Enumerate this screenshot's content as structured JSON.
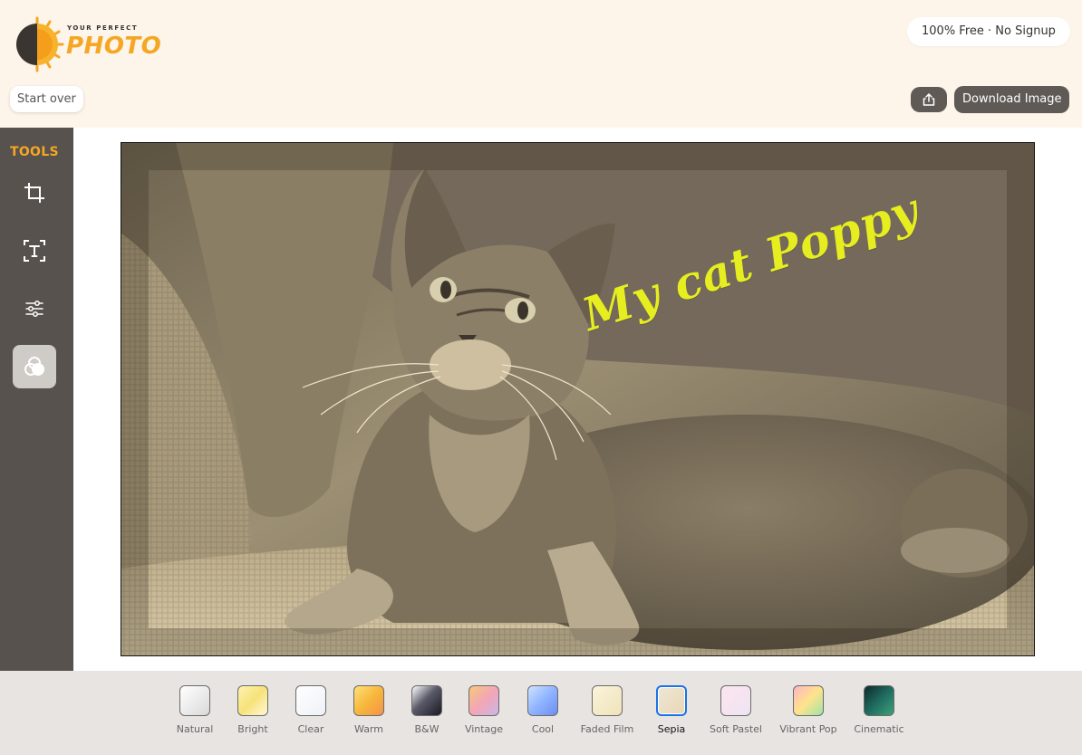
{
  "header": {
    "logo_small": "YOUR PERFECT",
    "logo_big": "PHOTO",
    "badge": "100% Free · No Signup",
    "start_over": "Start over",
    "download": "Download Image"
  },
  "sidebar": {
    "title": "TOOLS",
    "tools": [
      {
        "name": "crop",
        "icon": "crop-icon",
        "active": false
      },
      {
        "name": "text",
        "icon": "text-icon",
        "active": false
      },
      {
        "name": "adjust",
        "icon": "sliders-icon",
        "active": false
      },
      {
        "name": "filters",
        "icon": "filters-icon",
        "active": true
      }
    ]
  },
  "canvas": {
    "overlay_text": "My cat Poppy",
    "overlay_color": "#e6ee1f",
    "filter_applied": "Sepia"
  },
  "filters": {
    "selected": "Sepia",
    "items": [
      {
        "label": "Natural"
      },
      {
        "label": "Bright"
      },
      {
        "label": "Clear"
      },
      {
        "label": "Warm"
      },
      {
        "label": "B&W"
      },
      {
        "label": "Vintage"
      },
      {
        "label": "Cool"
      },
      {
        "label": "Faded Film"
      },
      {
        "label": "Sepia"
      },
      {
        "label": "Soft Pastel"
      },
      {
        "label": "Vibrant Pop"
      },
      {
        "label": "Cinematic"
      }
    ]
  },
  "colors": {
    "accent": "#f5a623",
    "sidebar_bg": "#57524e",
    "header_bg": "#fdf4ea",
    "selected_border": "#1a73e8",
    "button_dark": "#5f5a56"
  }
}
